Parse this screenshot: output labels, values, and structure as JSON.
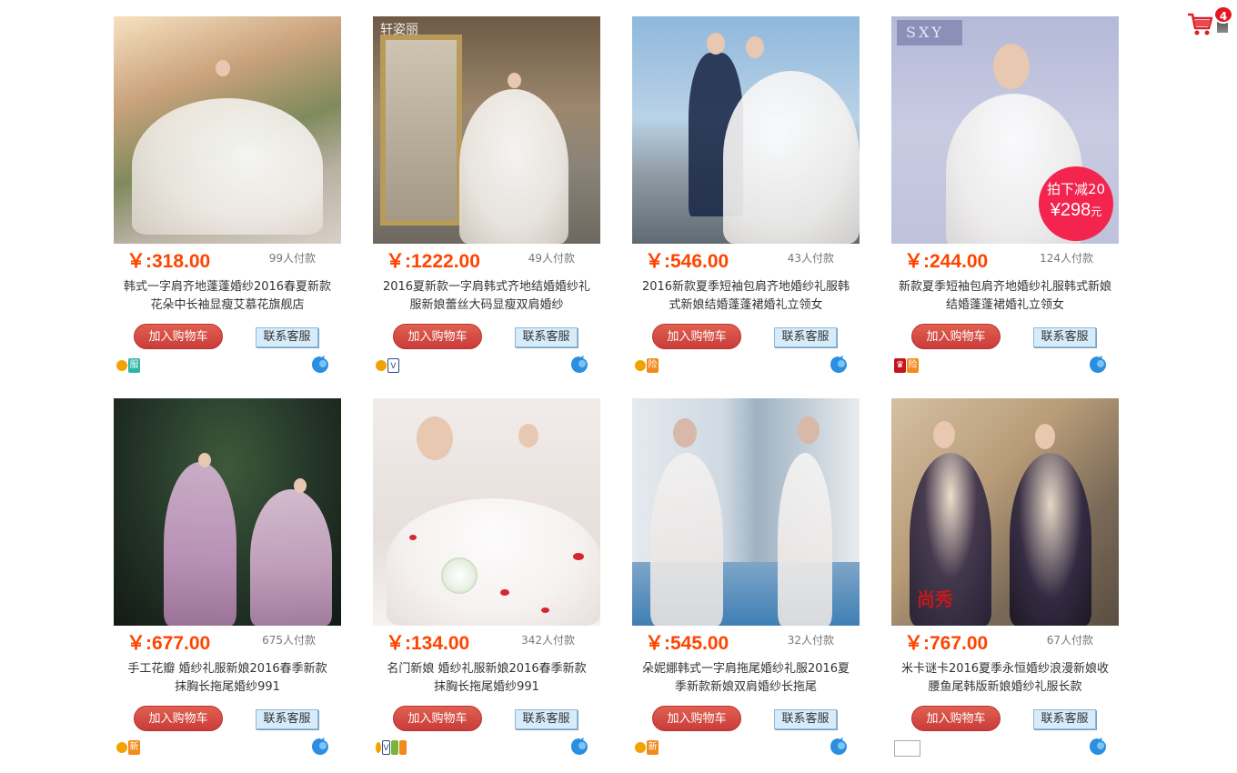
{
  "cart": {
    "count": "4",
    "icon": "shopping-cart-icon",
    "color": "#e4161e"
  },
  "labels": {
    "add_to_cart": "加入购物车",
    "contact_service": "联系客服"
  },
  "colors": {
    "price": "#ff4400",
    "cart_button": "#d9534f",
    "service_button": "#d7ecfb",
    "promo_badge": "#f3244e"
  },
  "products": [
    {
      "price": "￥:318.00",
      "sold": "99人付款",
      "title": "韩式一字肩齐地蓬蓬婚纱2016春夏新款花朵中长袖显瘦艾慕花旗舰店",
      "badges": [
        "gold-seller-icon",
        "service-icon"
      ]
    },
    {
      "price": "￥:1222.00",
      "sold": "49人付款",
      "title": "2016夏新款一字肩韩式齐地结婚婚纱礼服新娘蕾丝大码显瘦双肩婚纱",
      "badges": [
        "gold-seller-icon",
        "shield-icon"
      ],
      "watermark": "轩姿丽"
    },
    {
      "price": "￥:546.00",
      "sold": "43人付款",
      "title": "2016新款夏季短袖包肩齐地婚纱礼服韩式新娘结婚蓬蓬裙婚礼立领女",
      "badges": [
        "gold-seller-icon",
        "insurance-icon"
      ]
    },
    {
      "price": "￥:244.00",
      "sold": "124人付款",
      "title": "新款夏季短袖包肩齐地婚纱礼服韩式新娘结婚蓬蓬裙婚礼立领女",
      "badges": [
        "crown-icon",
        "insurance-icon"
      ],
      "watermark": "SXY",
      "promo": {
        "line1": "拍下减20",
        "price": "¥298",
        "unit": "元"
      }
    },
    {
      "price": "￥:677.00",
      "sold": "675人付款",
      "title": "手工花瓣 婚纱礼服新娘2016春季新款 抹胸长拖尾婚纱991",
      "badges": [
        "gold-seller-icon",
        "new-icon"
      ]
    },
    {
      "price": "￥:134.00",
      "sold": "342人付款",
      "title": "名门新娘 婚纱礼服新娘2016春季新款 抹胸长拖尾婚纱991",
      "badges": [
        "gold-seller-icon",
        "shield-icon",
        "service-icon",
        "insurance-icon"
      ]
    },
    {
      "price": "￥:545.00",
      "sold": "32人付款",
      "title": "朵妮娜韩式一字肩拖尾婚纱礼服2016夏季新款新娘双肩婚纱长拖尾",
      "badges": [
        "gold-seller-icon",
        "new-icon"
      ]
    },
    {
      "price": "￥:767.00",
      "sold": "67人付款",
      "title": "米卡谜卡2016夏季永恒婚纱浪漫新娘收腰鱼尾韩版新娘婚纱礼服长款",
      "badges": [
        "broken-image-icon"
      ],
      "watermark": "尚秀"
    }
  ]
}
